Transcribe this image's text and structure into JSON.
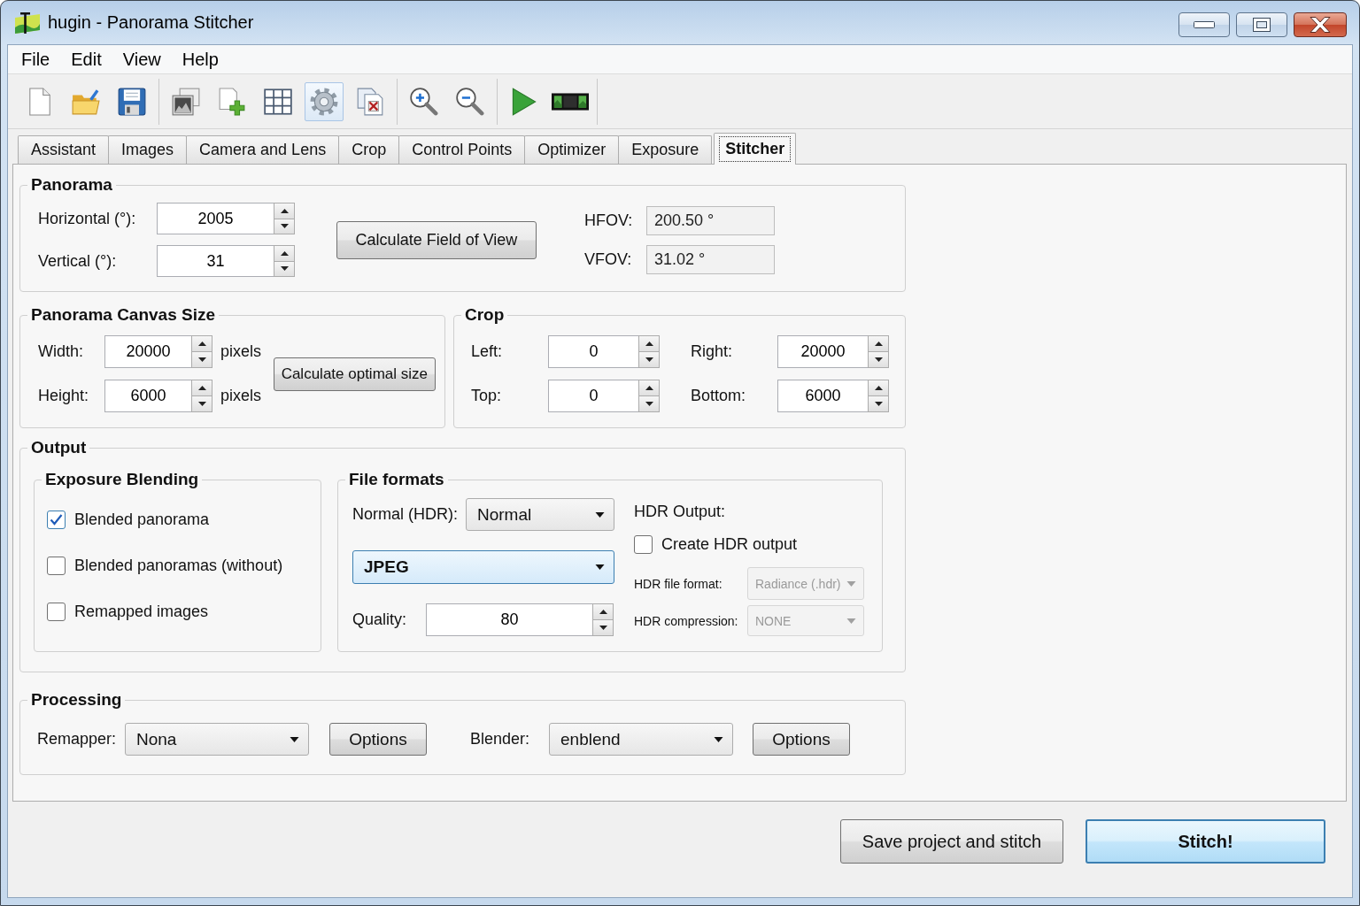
{
  "window": {
    "title": "hugin - Panorama Stitcher"
  },
  "menu": [
    "File",
    "Edit",
    "View",
    "Help"
  ],
  "toolbar": [
    [
      {
        "selected": false
      },
      {
        "selected": false
      },
      {
        "selected": false
      }
    ],
    [
      {
        "selected": false
      },
      {
        "selected": false
      },
      {
        "selected": false
      },
      {
        "selected": true
      },
      {
        "selected": false
      }
    ],
    [
      {
        "selected": false
      },
      {
        "selected": false
      }
    ],
    [
      {
        "selected": false
      },
      {
        "selected": false
      }
    ]
  ],
  "tabs": [
    {
      "label": "Assistant",
      "selected": false
    },
    {
      "label": "Images",
      "selected": false
    },
    {
      "label": "Camera and Lens",
      "selected": false
    },
    {
      "label": "Crop",
      "selected": false
    },
    {
      "label": "Control Points",
      "selected": false
    },
    {
      "label": "Optimizer",
      "selected": false
    },
    {
      "label": "Exposure",
      "selected": false
    },
    {
      "label": "Stitcher",
      "selected": true
    }
  ],
  "panorama": {
    "title": "Panorama",
    "fields": [
      {
        "label": "Horizontal (°):",
        "value": "2005"
      },
      {
        "label": "Vertical (°):",
        "value": "31"
      }
    ],
    "calculate_button": "Calculate Field of View",
    "fov": [
      {
        "label": "HFOV:",
        "value": "200.50 °"
      },
      {
        "label": "VFOV:",
        "value": "31.02 °"
      }
    ]
  },
  "canvas_size": {
    "title": "Panorama Canvas Size",
    "fields": [
      {
        "label": "Width:",
        "value": "20000",
        "unit": "pixels"
      },
      {
        "label": "Height:",
        "value": "6000",
        "unit": "pixels"
      }
    ],
    "calculate_button": "Calculate optimal size"
  },
  "crop": {
    "title": "Crop",
    "rows": [
      [
        {
          "label": "Left:",
          "value": "0"
        },
        {
          "label": "Right:",
          "value": "20000"
        }
      ],
      [
        {
          "label": "Top:",
          "value": "0"
        },
        {
          "label": "Bottom:",
          "value": "6000"
        }
      ]
    ]
  },
  "output": {
    "title": "Output",
    "exposure_blending": {
      "title": "Exposure Blending",
      "options": [
        {
          "label": "Blended panorama",
          "checked": true
        },
        {
          "label": "Blended panoramas (without)",
          "checked": false
        },
        {
          "label": "Remapped images",
          "checked": false
        }
      ]
    },
    "file_formats": {
      "title": "File formats",
      "normal": {
        "label": "Normal (HDR):",
        "value": "Normal"
      },
      "format": {
        "value": "JPEG",
        "focused": true
      },
      "quality": {
        "label": "Quality:",
        "value": "80"
      },
      "hdr_output": {
        "title": "HDR Output:",
        "create": {
          "label": "Create HDR output",
          "checked": false
        },
        "file_format": {
          "label": "HDR file format:",
          "value": "Radiance (.hdr)",
          "disabled": true
        },
        "compression": {
          "label": "HDR compression:",
          "value": "NONE",
          "disabled": true
        }
      }
    }
  },
  "processing": {
    "title": "Processing",
    "remapper": {
      "label": "Remapper:",
      "value": "Nona",
      "options_button": "Options"
    },
    "blender": {
      "label": "Blender:",
      "value": "enblend",
      "options_button": "Options"
    }
  },
  "buttons": [
    {
      "label": "Save project and stitch",
      "default": false
    },
    {
      "label": "Stitch!",
      "default": true
    }
  ]
}
